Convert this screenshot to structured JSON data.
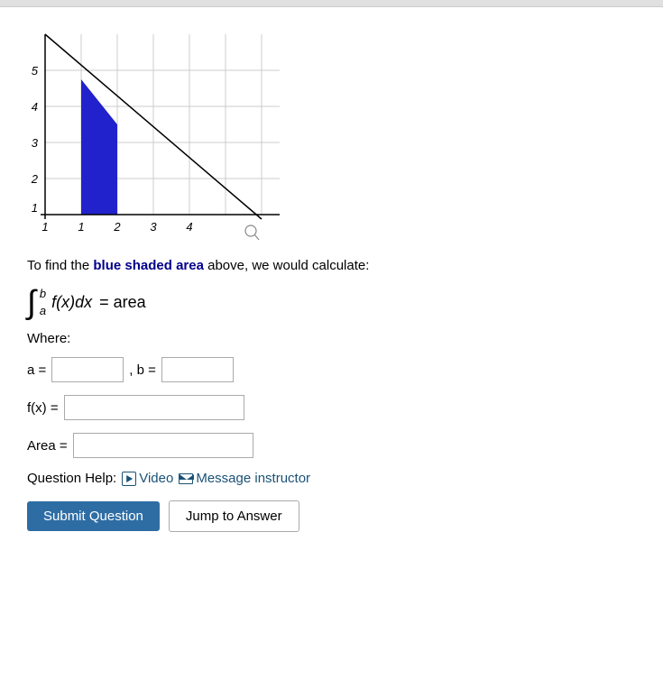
{
  "topbar": {},
  "description": {
    "text_before": "To find the ",
    "highlight": "blue shaded area",
    "text_after": " above, we would calculate:"
  },
  "integral": {
    "lower": "a",
    "upper": "b",
    "expression": "f(x)dx",
    "equals": "= area"
  },
  "where_label": "Where:",
  "fields": {
    "a_label": "a =",
    "b_label": ", b =",
    "fx_label": "f(x) =",
    "area_label": "Area ="
  },
  "question_help": {
    "label": "Question Help:",
    "video_label": "Video",
    "message_label": "Message instructor"
  },
  "buttons": {
    "submit": "Submit Question",
    "jump": "Jump to Answer"
  },
  "graph": {
    "blue_area": true,
    "x_max": 5,
    "y_max": 6
  }
}
